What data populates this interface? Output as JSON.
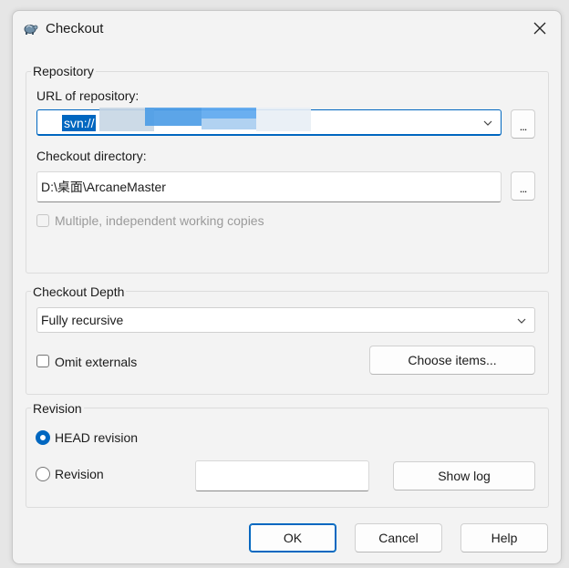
{
  "dialog": {
    "title": "Checkout"
  },
  "repository": {
    "group_label": "Repository",
    "url_label": "URL of repository:",
    "url_value": "svn://",
    "browse_label": "...",
    "checkout_dir_label": "Checkout directory:",
    "checkout_dir_value": "D:\\桌面\\ArcaneMaster",
    "dir_browse_label": "...",
    "multiple_copies_label": "Multiple, independent working copies",
    "multiple_copies_checked": false
  },
  "depth": {
    "group_label": "Checkout Depth",
    "selected": "Fully recursive",
    "omit_externals_label": "Omit externals",
    "omit_externals_checked": false,
    "choose_items_label": "Choose items..."
  },
  "revision": {
    "group_label": "Revision",
    "head_label": "HEAD revision",
    "head_selected": true,
    "revision_label": "Revision",
    "revision_value": "",
    "show_log_label": "Show log"
  },
  "buttons": {
    "ok": "OK",
    "cancel": "Cancel",
    "help": "Help"
  },
  "colors": {
    "accent": "#0067c0"
  }
}
